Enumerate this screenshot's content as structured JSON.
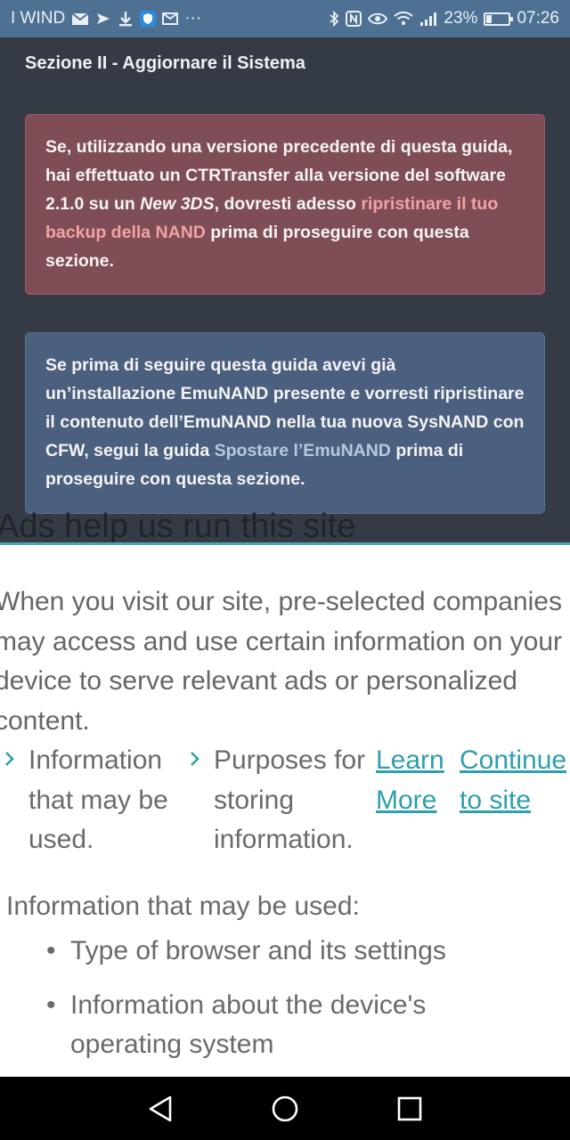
{
  "status_bar": {
    "carrier": "I WIND",
    "battery": "23%",
    "battery_level": 0.23,
    "time": "07:26",
    "more": "···",
    "left_icons": [
      "mail-icon",
      "nfc-send-icon",
      "download-icon",
      "shield-icon",
      "email-icon"
    ],
    "right_icons": [
      "bluetooth-icon",
      "nfc-icon",
      "eye-icon",
      "wifi-icon",
      "signal-icon",
      "battery-icon"
    ]
  },
  "guide": {
    "section_title": "Sezione II - Aggiornare il Sistema",
    "danger_alert": {
      "text_1": "Se, utilizzando una versione precedente di questa guida, hai effettuato un CTRTransfer alla versione del software 2.1.0 su un ",
      "italic": "New 3DS",
      "text_2": ", dovresti adesso ",
      "link": "ripristinare il tuo backup della NAND",
      "text_3": " prima di proseguire con questa sezione."
    },
    "info_alert": {
      "text_1": "Se prima di seguire questa guida avevi già un’installazione EmuNAND presente e vorresti ripristinare il contenuto dell’EmuNAND nella tua nuova SysNAND con CFW, segui la guida ",
      "link": "Spostare l’EmuNAND",
      "text_2": " prima di proseguire con questa sezione."
    }
  },
  "consent": {
    "heading": "Ads help us run this site",
    "intro": "When you visit our site, pre-selected companies may access and use certain information on your device to serve relevant ads or personalized content.",
    "option_1": "Information that may be used.",
    "option_2": "Purposes for storing information.",
    "learn_more": "Learn More",
    "continue": "Continue to site",
    "info_title": "Information that may be used:",
    "info_items": [
      "Type of browser and its settings",
      "Information about the device's operating system"
    ]
  },
  "nav": {
    "back": "back-icon",
    "home": "home-icon",
    "recents": "recents-icon"
  },
  "colors": {
    "status_bar": "#4e7193",
    "page_bg": "#343b44",
    "danger_bg": "#7f4d56",
    "info_bg": "#4b5f7f",
    "accent": "#2e9fad"
  }
}
